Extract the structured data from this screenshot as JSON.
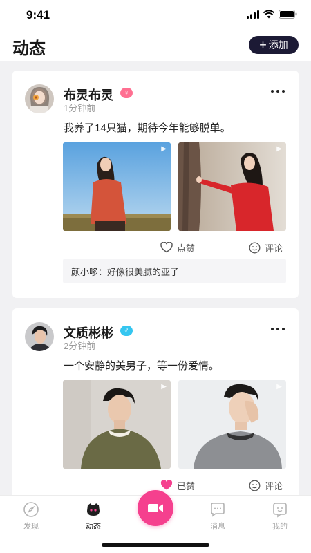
{
  "status_bar": {
    "time": "9:41"
  },
  "header": {
    "title": "动态",
    "add_label": "添加",
    "add_symbol": "+"
  },
  "posts": [
    {
      "user_name": "布灵布灵",
      "gender": "female",
      "gender_symbol": "♀",
      "time": "1分钟前",
      "text": "我养了14只猫，期待今年能够脱单。",
      "like_label": "点赞",
      "liked": false,
      "comment_label": "评论",
      "comment": {
        "author": "颜小哆：",
        "text": "好像很美腻的亚子"
      }
    },
    {
      "user_name": "文质彬彬",
      "gender": "male",
      "gender_symbol": "♂",
      "time": "2分钟前",
      "text": "一个安静的美男子，等一份爱情。",
      "like_label": "已赞",
      "liked": true,
      "comment_label": "评论"
    }
  ],
  "tabbar": {
    "items": [
      {
        "label": "发现",
        "icon": "compass-icon",
        "active": false
      },
      {
        "label": "动态",
        "icon": "feed-icon",
        "active": true
      },
      {
        "label": "消息",
        "icon": "message-icon",
        "active": false
      },
      {
        "label": "我的",
        "icon": "profile-icon",
        "active": false
      }
    ],
    "center_icon": "video-camera-icon"
  },
  "colors": {
    "accent": "#f5408e",
    "add_button": "#1c1a35",
    "female": "#ff6f91",
    "male": "#35c6f0"
  }
}
